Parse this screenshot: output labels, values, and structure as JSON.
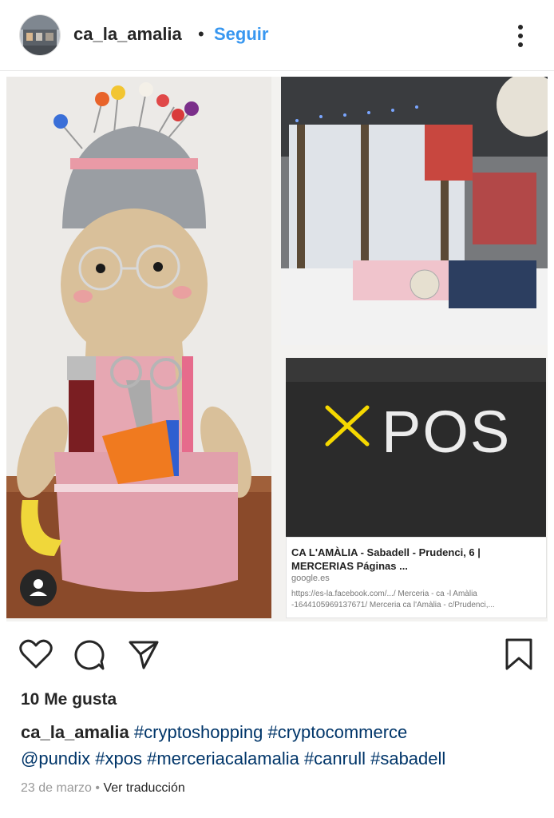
{
  "header": {
    "username": "ca_la_amalia",
    "separator": "•",
    "follow_label": "Seguir",
    "menu_icon": "more-vertical-icon"
  },
  "post": {
    "link_card": {
      "title": "CA L'AMÀLIA - Sabadell - Prudenci, 6 | MERCERIAS Páginas ...",
      "source": "google.es",
      "url": "https://es-la.facebook.com/.../ Merceria - ca -l Amàlia -1644105969137671/ Merceria ca l'Amàlia - c/Prudenci,..."
    },
    "xpos_label": "POS",
    "user_tag_icon": "user-tag-icon"
  },
  "actions": {
    "like_icon": "heart-icon",
    "comment_icon": "comment-icon",
    "share_icon": "send-icon",
    "save_icon": "bookmark-icon"
  },
  "likes": "10 Me gusta",
  "caption": {
    "username": "ca_la_amalia",
    "hashtags_line1": "#cryptoshopping #cryptocommerce",
    "hashtags_line2": "@pundix #xpos #merceriacalamalia #canrull #sabadell"
  },
  "meta": {
    "date": "23 de marzo",
    "separator": "•",
    "translate_label": "Ver traducción"
  },
  "colors": {
    "link_blue": "#3897f0",
    "hashtag_blue": "#003569",
    "text": "#262626",
    "muted": "#999999",
    "xpos_yellow": "#f5d800"
  }
}
